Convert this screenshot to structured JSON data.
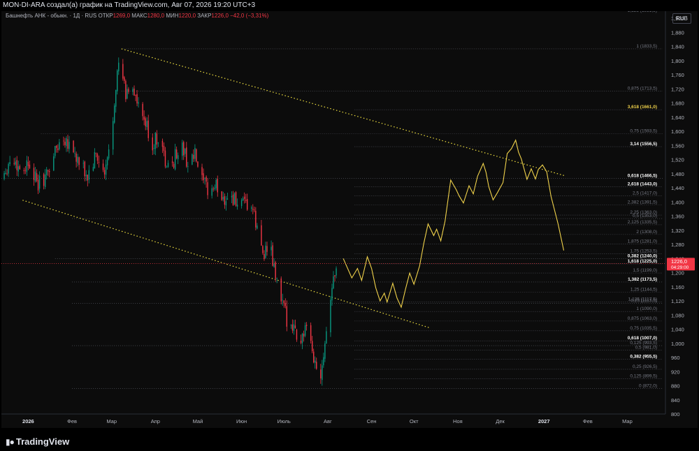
{
  "header": {
    "title": "MON-DI-ARA создал(а) график на TradingView.com, Авг 07, 2026 19:20 UTC+3"
  },
  "legend": {
    "symbol": "Башнефть АНК - обыкн. · 1Д · RUS",
    "open_label": "ОТКР",
    "open_value": "1269,0",
    "high_label": "МАКС",
    "high_value": "1280,0",
    "low_label": "МИН",
    "low_value": "1220,0",
    "close_label": "ЗАКР",
    "close_value": "1226,0 −42,0 (−3,31%)"
  },
  "price_axis": {
    "currency": "RUB",
    "current_price": "1226,0",
    "countdown": "04:29:00",
    "top_partial_label": "1,125 (1951,5)"
  },
  "footer": {
    "logo_text": "TradingView"
  },
  "colors": {
    "background": "#0c0c0c",
    "up_candle": "#089981",
    "down_candle": "#f23645",
    "forecast_line": "#f0d24b",
    "channel_line": "#f0e040",
    "fib_line": "#5d606b",
    "current_price": "#f23645"
  },
  "chart_data": {
    "type": "candlestick",
    "symbol": "Башнефть АНК - обыкн.",
    "interval": "1Д",
    "currency": "RUB",
    "ylim": [
      800,
      1940
    ],
    "y_ticks": [
      800,
      840,
      880,
      920,
      960,
      1000,
      1040,
      1080,
      1120,
      1160,
      1200,
      1240,
      1280,
      1320,
      1360,
      1400,
      1440,
      1480,
      1520,
      1560,
      1600,
      1640,
      1680,
      1720,
      1760,
      1800,
      1840,
      1880,
      1920
    ],
    "x_range": [
      "2025-12-13",
      "2027-03-28"
    ],
    "x_ticks": [
      {
        "date": "2026-01-01",
        "label": "2026"
      },
      {
        "date": "2026-02-01",
        "label": "Фев"
      },
      {
        "date": "2026-03-01",
        "label": "Мар"
      },
      {
        "date": "2026-04-01",
        "label": "Апр"
      },
      {
        "date": "2026-05-01",
        "label": "Май"
      },
      {
        "date": "2026-06-01",
        "label": "Июн"
      },
      {
        "date": "2026-07-01",
        "label": "Июль"
      },
      {
        "date": "2026-08-01",
        "label": "Авг"
      },
      {
        "date": "2026-09-01",
        "label": "Сен"
      },
      {
        "date": "2026-10-01",
        "label": "Окт"
      },
      {
        "date": "2026-11-01",
        "label": "Ноя"
      },
      {
        "date": "2026-12-01",
        "label": "Дек"
      },
      {
        "date": "2027-01-01",
        "label": "2027"
      },
      {
        "date": "2027-02-01",
        "label": "Фев"
      },
      {
        "date": "2027-03-01",
        "label": "Мар"
      }
    ],
    "price_path": [
      {
        "date": "2025-12-13",
        "price": 1470
      },
      {
        "date": "2025-12-20",
        "price": 1525
      },
      {
        "date": "2025-12-27",
        "price": 1490
      },
      {
        "date": "2026-01-03",
        "price": 1520
      },
      {
        "date": "2026-01-07",
        "price": 1445
      },
      {
        "date": "2026-01-14",
        "price": 1475
      },
      {
        "date": "2026-01-20",
        "price": 1545
      },
      {
        "date": "2026-01-26",
        "price": 1585
      },
      {
        "date": "2026-01-31",
        "price": 1565
      },
      {
        "date": "2026-02-06",
        "price": 1505
      },
      {
        "date": "2026-02-12",
        "price": 1470
      },
      {
        "date": "2026-02-18",
        "price": 1530
      },
      {
        "date": "2026-02-24",
        "price": 1470
      },
      {
        "date": "2026-03-01",
        "price": 1590
      },
      {
        "date": "2026-03-04",
        "price": 1740
      },
      {
        "date": "2026-03-07",
        "price": 1800
      },
      {
        "date": "2026-03-11",
        "price": 1700
      },
      {
        "date": "2026-03-15",
        "price": 1745
      },
      {
        "date": "2026-03-20",
        "price": 1660
      },
      {
        "date": "2026-03-25",
        "price": 1620
      },
      {
        "date": "2026-03-30",
        "price": 1560
      },
      {
        "date": "2026-04-04",
        "price": 1595
      },
      {
        "date": "2026-04-09",
        "price": 1490
      },
      {
        "date": "2026-04-14",
        "price": 1520
      },
      {
        "date": "2026-04-19",
        "price": 1565
      },
      {
        "date": "2026-04-24",
        "price": 1510
      },
      {
        "date": "2026-04-29",
        "price": 1530
      },
      {
        "date": "2026-05-04",
        "price": 1455
      },
      {
        "date": "2026-05-09",
        "price": 1430
      },
      {
        "date": "2026-05-14",
        "price": 1445
      },
      {
        "date": "2026-05-19",
        "price": 1410
      },
      {
        "date": "2026-05-24",
        "price": 1420
      },
      {
        "date": "2026-05-29",
        "price": 1395
      },
      {
        "date": "2026-06-03",
        "price": 1385
      },
      {
        "date": "2026-06-08",
        "price": 1390
      },
      {
        "date": "2026-06-12",
        "price": 1320
      },
      {
        "date": "2026-06-16",
        "price": 1260
      },
      {
        "date": "2026-06-21",
        "price": 1270
      },
      {
        "date": "2026-06-25",
        "price": 1190
      },
      {
        "date": "2026-06-29",
        "price": 1120
      },
      {
        "date": "2026-07-03",
        "price": 1070
      },
      {
        "date": "2026-07-07",
        "price": 1060
      },
      {
        "date": "2026-07-12",
        "price": 1000
      },
      {
        "date": "2026-07-16",
        "price": 1040
      },
      {
        "date": "2026-07-20",
        "price": 990
      },
      {
        "date": "2026-07-24",
        "price": 930
      },
      {
        "date": "2026-07-26",
        "price": 890
      },
      {
        "date": "2026-07-28",
        "price": 950
      },
      {
        "date": "2026-07-31",
        "price": 1040
      },
      {
        "date": "2026-08-03",
        "price": 1140
      },
      {
        "date": "2026-08-06",
        "price": 1200
      },
      {
        "date": "2026-08-07",
        "price": 1226
      }
    ],
    "forecast_line": [
      {
        "date": "2026-08-12",
        "price": 1240
      },
      {
        "date": "2026-08-18",
        "price": 1185
      },
      {
        "date": "2026-08-22",
        "price": 1212
      },
      {
        "date": "2026-08-25",
        "price": 1178
      },
      {
        "date": "2026-08-29",
        "price": 1245
      },
      {
        "date": "2026-09-01",
        "price": 1212
      },
      {
        "date": "2026-09-04",
        "price": 1157
      },
      {
        "date": "2026-09-07",
        "price": 1120
      },
      {
        "date": "2026-09-10",
        "price": 1142
      },
      {
        "date": "2026-09-12",
        "price": 1117
      },
      {
        "date": "2026-09-16",
        "price": 1170
      },
      {
        "date": "2026-09-19",
        "price": 1128
      },
      {
        "date": "2026-09-22",
        "price": 1102
      },
      {
        "date": "2026-09-25",
        "price": 1153
      },
      {
        "date": "2026-09-28",
        "price": 1199
      },
      {
        "date": "2026-10-01",
        "price": 1167
      },
      {
        "date": "2026-10-05",
        "price": 1219
      },
      {
        "date": "2026-10-08",
        "price": 1284
      },
      {
        "date": "2026-10-11",
        "price": 1338
      },
      {
        "date": "2026-10-15",
        "price": 1305
      },
      {
        "date": "2026-10-17",
        "price": 1323
      },
      {
        "date": "2026-10-20",
        "price": 1290
      },
      {
        "date": "2026-10-23",
        "price": 1346
      },
      {
        "date": "2026-10-27",
        "price": 1462
      },
      {
        "date": "2026-10-31",
        "price": 1434
      },
      {
        "date": "2026-11-02",
        "price": 1417
      },
      {
        "date": "2026-11-05",
        "price": 1397
      },
      {
        "date": "2026-11-09",
        "price": 1446
      },
      {
        "date": "2026-11-12",
        "price": 1423
      },
      {
        "date": "2026-11-15",
        "price": 1473
      },
      {
        "date": "2026-11-19",
        "price": 1509
      },
      {
        "date": "2026-11-21",
        "price": 1484
      },
      {
        "date": "2026-11-23",
        "price": 1443
      },
      {
        "date": "2026-11-26",
        "price": 1406
      },
      {
        "date": "2026-11-29",
        "price": 1426
      },
      {
        "date": "2026-12-03",
        "price": 1455
      },
      {
        "date": "2026-12-06",
        "price": 1537
      },
      {
        "date": "2026-12-09",
        "price": 1551
      },
      {
        "date": "2026-12-12",
        "price": 1575
      },
      {
        "date": "2026-12-14",
        "price": 1541
      },
      {
        "date": "2026-12-16",
        "price": 1522
      },
      {
        "date": "2026-12-20",
        "price": 1464
      },
      {
        "date": "2026-12-23",
        "price": 1494
      },
      {
        "date": "2026-12-26",
        "price": 1465
      },
      {
        "date": "2026-12-28",
        "price": 1492
      },
      {
        "date": "2026-12-31",
        "price": 1505
      },
      {
        "date": "2027-01-03",
        "price": 1485
      },
      {
        "date": "2027-01-06",
        "price": 1416
      },
      {
        "date": "2027-01-11",
        "price": 1338
      },
      {
        "date": "2027-01-15",
        "price": 1263
      }
    ],
    "channel_lines": [
      {
        "start": {
          "date": "2026-03-08",
          "price": 1833.5
        },
        "end": {
          "date": "2027-01-16",
          "price": 1474
        }
      },
      {
        "start": {
          "date": "2025-12-28",
          "price": 1405
        },
        "end": {
          "date": "2026-10-12",
          "price": 1044
        }
      }
    ],
    "fib_levels": [
      {
        "label": "1 (1833,5)",
        "price": 1833.5,
        "start": "2026-03-08",
        "color": "#787b86"
      },
      {
        "label": "0,875 (1713,5)",
        "price": 1713.5,
        "start": "2026-03-08",
        "color": "#787b86"
      },
      {
        "label": "3,618 (1661,0)",
        "price": 1661.0,
        "start": "2026-08-20",
        "color": "#f0d24b",
        "bold": true
      },
      {
        "label": "0,75 (1593,5)",
        "price": 1593.5,
        "start": "2026-01-10",
        "color": "#787b86"
      },
      {
        "label": "3,14 (1556,5)",
        "price": 1556.5,
        "start": "2026-08-20",
        "color": "#ffffff",
        "bold": true
      },
      {
        "label": "0,618 (1466,5)",
        "price": 1466.5,
        "start": "2025-12-13",
        "color": "#ffffff",
        "bold": true
      },
      {
        "label": "2,618 (1443,0)",
        "price": 1443.0,
        "start": "2026-08-20",
        "color": "#ffffff",
        "bold": true
      },
      {
        "label": "2,5 (1417,0)",
        "price": 1417.0,
        "start": "2026-08-20",
        "color": "#787b86"
      },
      {
        "label": "2,382 (1391,5)",
        "price": 1391.5,
        "start": "2026-08-20",
        "color": "#787b86"
      },
      {
        "label": "2,25 (1363,0)",
        "price": 1363.0,
        "start": "2026-08-20",
        "color": "#787b86"
      },
      {
        "label": "0,5 (1353,0)",
        "price": 1353.0,
        "start": "2026-02-01",
        "color": "#787b86"
      },
      {
        "label": "2,125 (1335,5)",
        "price": 1335.5,
        "start": "2026-08-20",
        "color": "#787b86"
      },
      {
        "label": "2 (1308,0)",
        "price": 1308.0,
        "start": "2026-08-20",
        "color": "#787b86"
      },
      {
        "label": "1,875 (1281,0)",
        "price": 1281.0,
        "start": "2026-08-20",
        "color": "#787b86"
      },
      {
        "label": "1,75 (1253,5)",
        "price": 1253.5,
        "start": "2026-08-20",
        "color": "#787b86"
      },
      {
        "label": "0,382 (1240,0)",
        "price": 1240.0,
        "start": "2026-01-20",
        "color": "#ffffff",
        "bold": true
      },
      {
        "label": "1,618 (1225,0)",
        "price": 1225.0,
        "start": "2026-08-20",
        "color": "#ffffff",
        "bold": true
      },
      {
        "label": "1,5 (1199,0)",
        "price": 1199.0,
        "start": "2026-08-20",
        "color": "#787b86"
      },
      {
        "label": "1,382 (1173,5)",
        "price": 1173.5,
        "start": "2026-02-01",
        "color": "#ffffff",
        "bold": true
      },
      {
        "label": "1,25 (1144,5)",
        "price": 1144.5,
        "start": "2026-08-20",
        "color": "#787b86"
      },
      {
        "label": "1,125 (1117,5)",
        "price": 1117.5,
        "start": "2026-08-20",
        "color": "#787b86"
      },
      {
        "label": "0,25 (1113,5)",
        "price": 1113.5,
        "start": "2026-02-01",
        "color": "#787b86"
      },
      {
        "label": "1 (1090,0)",
        "price": 1090.0,
        "start": "2026-08-20",
        "color": "#787b86"
      },
      {
        "label": "0,875 (1063,0)",
        "price": 1063.0,
        "start": "2026-08-20",
        "color": "#787b86"
      },
      {
        "label": "0,75 (1035,5)",
        "price": 1035.5,
        "start": "2026-08-20",
        "color": "#787b86"
      },
      {
        "label": "0,618 (1007,0)",
        "price": 1007.0,
        "start": "2026-08-20",
        "color": "#ffffff",
        "bold": true
      },
      {
        "label": "0,125 (993,5)",
        "price": 993.5,
        "start": "2026-02-01",
        "color": "#787b86"
      },
      {
        "label": "0,5 (981,0)",
        "price": 981.0,
        "start": "2026-08-20",
        "color": "#787b86"
      },
      {
        "label": "0,382 (955,5)",
        "price": 955.5,
        "start": "2026-08-20",
        "color": "#ffffff",
        "bold": true
      },
      {
        "label": "0,25 (926,5)",
        "price": 926.5,
        "start": "2026-08-20",
        "color": "#787b86"
      },
      {
        "label": "0,125 (899,5)",
        "price": 899.5,
        "start": "2026-08-20",
        "color": "#787b86"
      },
      {
        "label": "0 (872,0)",
        "price": 872.0,
        "start": "2026-02-01",
        "color": "#787b86"
      }
    ],
    "current_price": 1226.0,
    "current_price_label": "1226,0",
    "countdown": "04:29:00"
  }
}
